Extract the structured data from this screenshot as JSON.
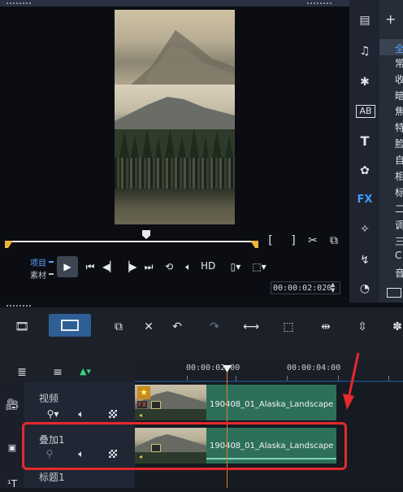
{
  "preview": {
    "mode_project": "项目",
    "mode_clip": "素材",
    "hd_label": "HD",
    "timecode": "00:00:02:020"
  },
  "library": {
    "list_items": [
      "全",
      "常",
      "收",
      "暗",
      "焦",
      "特",
      "脸",
      "自",
      "相",
      "标",
      "二",
      "调",
      "三",
      "C",
      "音"
    ]
  },
  "timeline": {
    "ruler_labels": [
      "00:00:02:00",
      "00:00:04:00"
    ],
    "tracks": [
      {
        "name": "视频",
        "clip": "190408_01_Alaska_Landscape"
      },
      {
        "name": "叠加1",
        "clip": "190408_01_Alaska_Landscape"
      },
      {
        "name": "标题1"
      }
    ]
  },
  "colors": {
    "accent_blue": "#2d5f94",
    "clip_green": "#2e6f5a",
    "playhead_orange": "#e27b2c",
    "highlight_red": "#e5292d",
    "in_out_marker": "#f0b43c"
  }
}
